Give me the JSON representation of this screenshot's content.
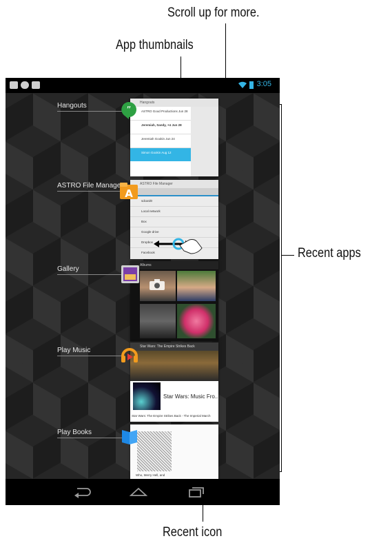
{
  "callouts": {
    "scroll_up": "Scroll up for more.",
    "app_thumbnails": "App thumbnails",
    "recent_apps": "Recent apps",
    "recent_icon": "Recent icon"
  },
  "status_bar": {
    "time": "3:05"
  },
  "apps": [
    {
      "name": "Hangouts"
    },
    {
      "name": "ASTRO File Manager"
    },
    {
      "name": "Gallery"
    },
    {
      "name": "Play Music"
    },
    {
      "name": "Play Books"
    }
  ],
  "thumbnails": {
    "hangouts": {
      "header": "Hangouts",
      "rows": [
        {
          "title": "ASTRO Good Productions",
          "time": "Jun 28"
        },
        {
          "title": "Jeremiah, Sandy, +4",
          "time": "Jun 28"
        },
        {
          "title": "Jeremiah Gookin",
          "time": "Jun 24"
        },
        {
          "title": "Simon Gookin",
          "time": "Aug 12"
        }
      ]
    },
    "astro": {
      "header": "ASTRO File Manager",
      "rows": [
        "sdcard0",
        "Local network",
        "Box",
        "Google drive",
        "Dropbox",
        "Facebook"
      ]
    },
    "gallery": {
      "header": "Albums"
    },
    "music": {
      "header": "Star Wars: The Empire Strikes Back",
      "album": "Star Wars: Music Fro...",
      "footer": "Star Wars: The Empire Strikes Back - The Imperial March"
    },
    "books": {
      "caption": "Who, Merry Hell, and"
    }
  },
  "colors": {
    "status_accent": "#35b5e5",
    "hangouts_green": "#2ea043",
    "selection_blue": "#33b5e5"
  }
}
